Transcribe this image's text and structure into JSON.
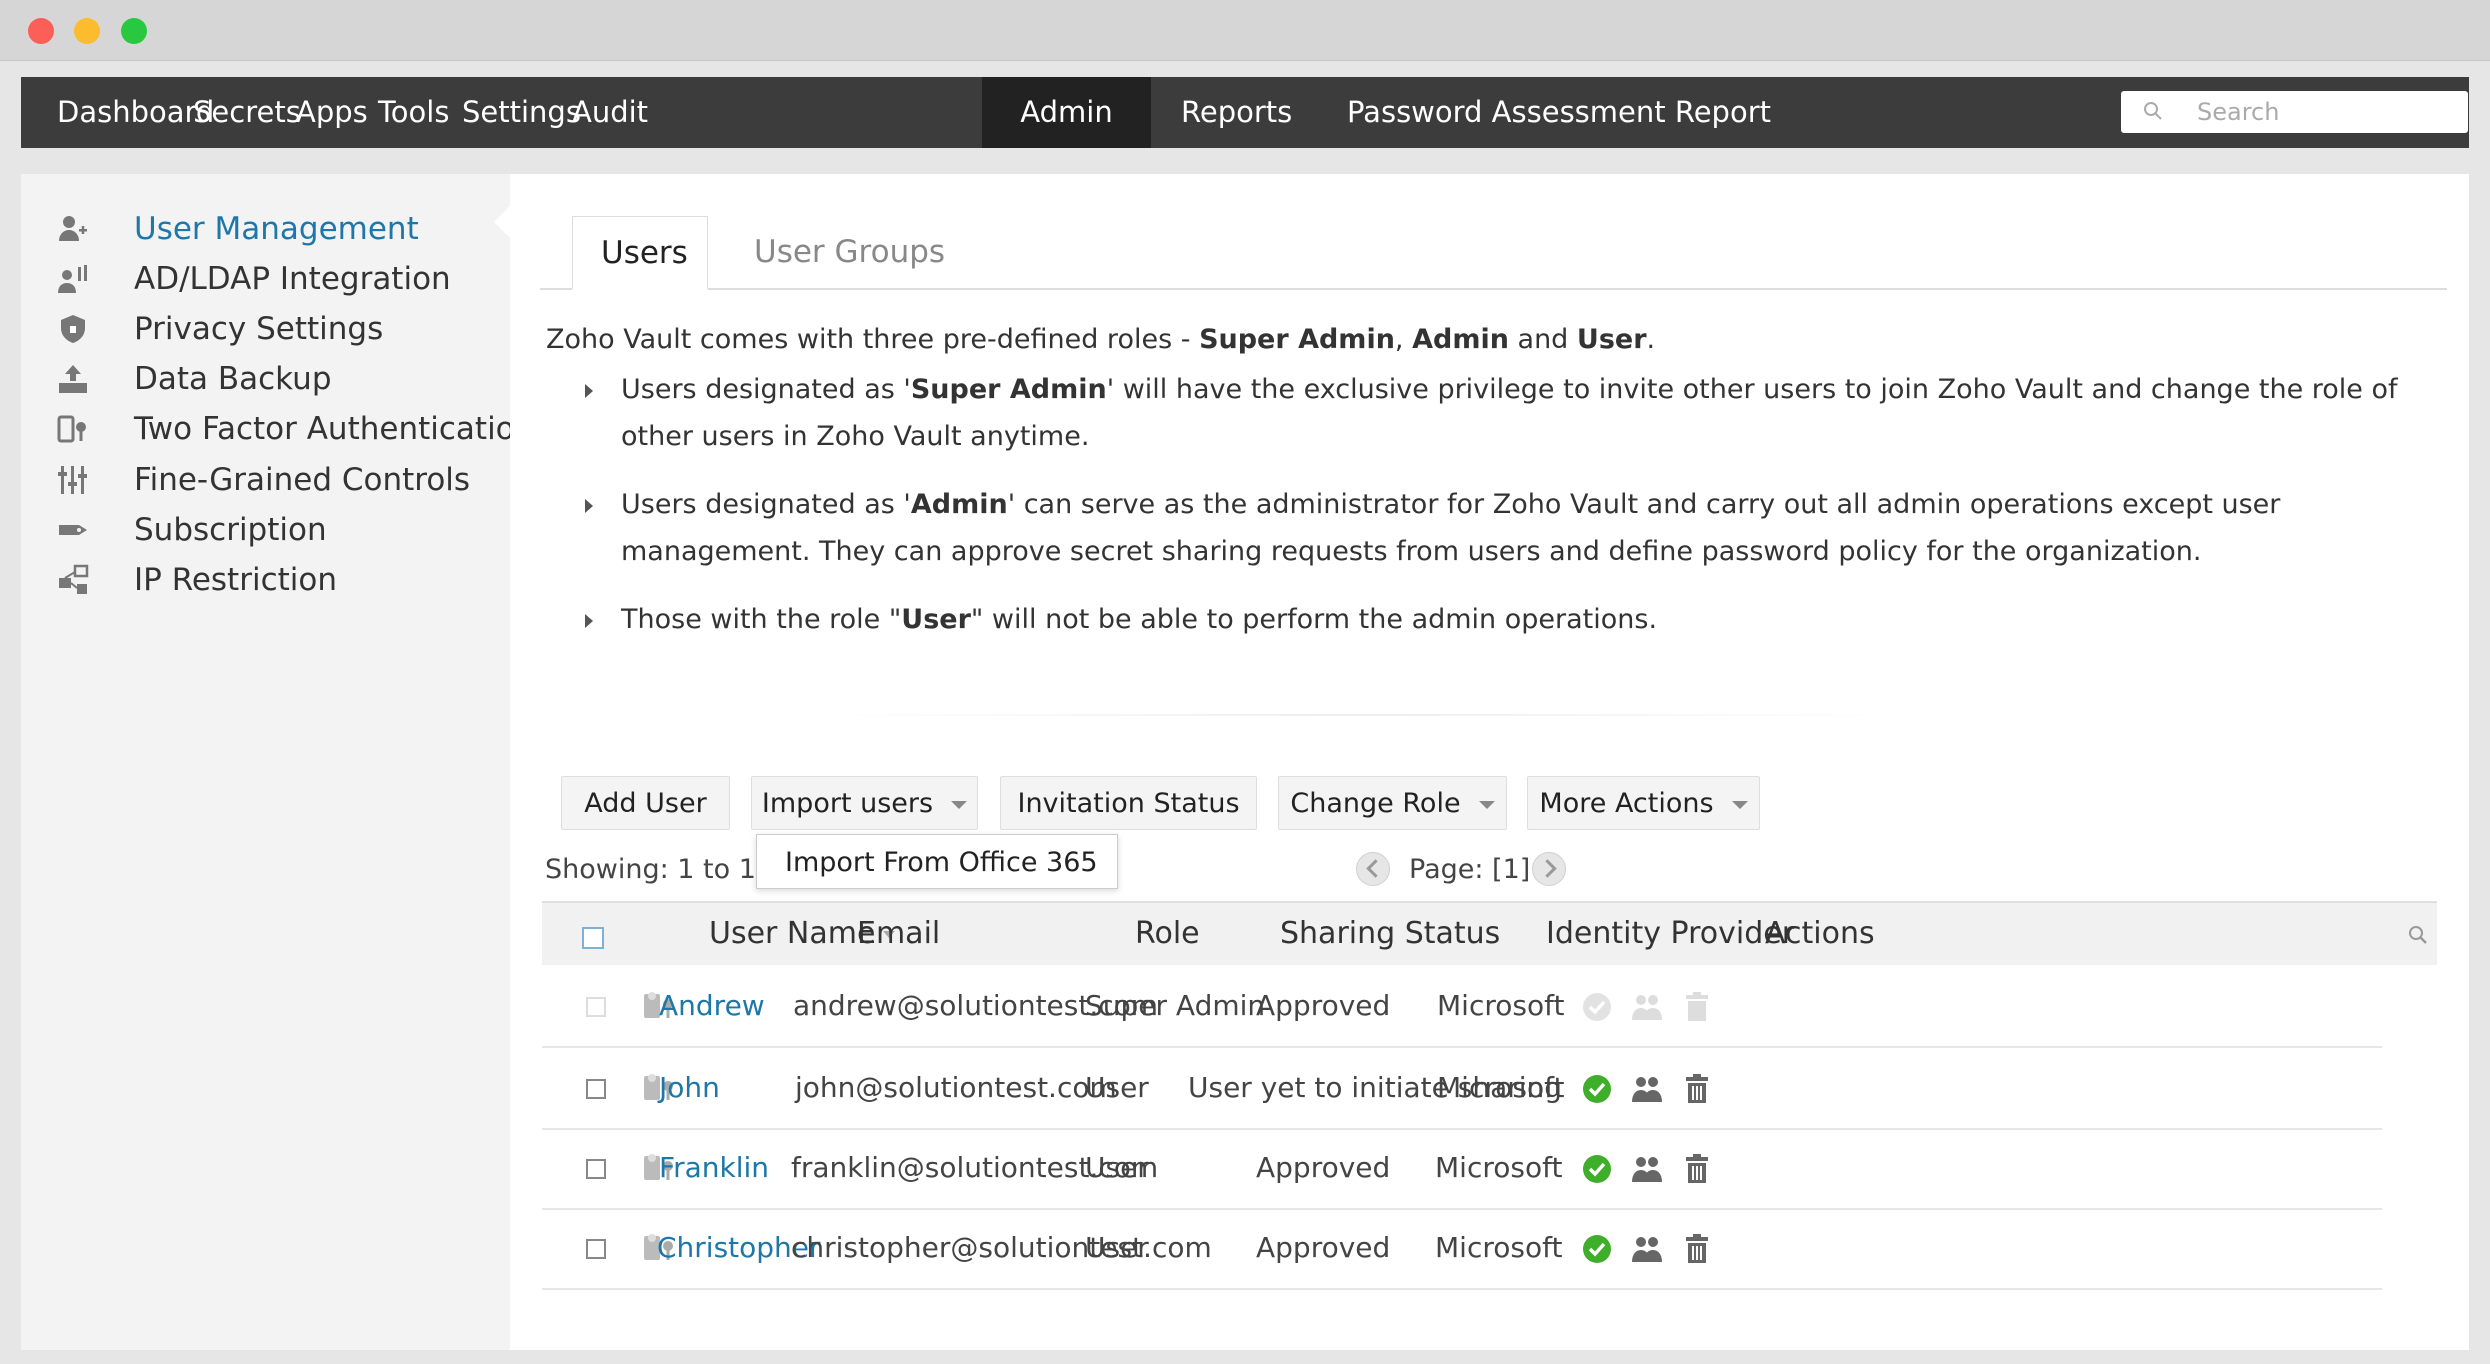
{
  "nav": {
    "items": [
      "Dashboard",
      "Secrets",
      "Apps",
      "Tools",
      "Settings",
      "Audit",
      "Admin",
      "Reports",
      "Password Assessment Report"
    ],
    "active": "Admin",
    "search_placeholder": "Search"
  },
  "sidebar": {
    "items": [
      {
        "label": "User Management",
        "icon": "user-add-icon",
        "active": true
      },
      {
        "label": "AD/LDAP Integration",
        "icon": "directory-sync-icon",
        "active": false
      },
      {
        "label": "Privacy Settings",
        "icon": "shield-icon",
        "active": false
      },
      {
        "label": "Data Backup",
        "icon": "backup-icon",
        "active": false
      },
      {
        "label": "Two Factor Authentication",
        "icon": "two-factor-icon",
        "active": false
      },
      {
        "label": "Fine-Grained Controls",
        "icon": "sliders-icon",
        "active": false
      },
      {
        "label": "Subscription",
        "icon": "tag-icon",
        "active": false
      },
      {
        "label": "IP Restriction",
        "icon": "network-icon",
        "active": false
      }
    ]
  },
  "tabs": [
    "Users",
    "User Groups"
  ],
  "intro": {
    "text": "Zoho Vault comes with three pre-defined roles - ",
    "r1": "Super Admin",
    "sep": ", ",
    "r2": "Admin",
    "and": " and ",
    "r3": "User",
    "end": "."
  },
  "bullets": [
    {
      "pre": "Users designated as '",
      "bold": "Super Admin",
      "post": "' will have the exclusive privilege to invite other users to join Zoho Vault and change the role of other users in Zoho Vault anytime."
    },
    {
      "pre": "Users designated as '",
      "bold": "Admin",
      "post": "' can serve as the administrator for Zoho Vault and carry out all admin operations except user management. They can approve secret sharing requests from users and define password policy for the organization."
    },
    {
      "pre": "Those with the role \"",
      "bold": "User",
      "post": "\" will not be able to perform the admin operations."
    }
  ],
  "toolbar": {
    "add_user": "Add User",
    "import_users": "Import users",
    "invitation_status": "Invitation Status",
    "change_role": "Change Role",
    "more_actions": "More Actions"
  },
  "dropdown": {
    "import_office365": "Import From Office 365"
  },
  "showing": "Showing: 1 to 1 o",
  "pager": {
    "label": "Page: [1]"
  },
  "table": {
    "headers": {
      "username": "User Name",
      "email": "Email",
      "role": "Role",
      "sharing": "Sharing Status",
      "idp": "Identity Provider",
      "actions": "Actions"
    },
    "rows": [
      {
        "name": "Andrew",
        "email": "andrew@solutiontest.com",
        "role": "Super Admin",
        "sharing": "Approved",
        "idp": "Microsoft",
        "disabled": true
      },
      {
        "name": "John",
        "email": "john@solutiontest.com",
        "role": "User",
        "sharing": "User yet to initiate sharing",
        "idp": "Microsoft",
        "disabled": false
      },
      {
        "name": "Franklin",
        "email": "franklin@solutiontest.com",
        "role": "User",
        "sharing": "Approved",
        "idp": "Microsoft",
        "disabled": false
      },
      {
        "name": "Christopher",
        "email": "christopher@solutiontest.com",
        "role": "User",
        "sharing": "Approved",
        "idp": "Microsoft",
        "disabled": false
      }
    ]
  },
  "colors": {
    "navbar": "#3c3c3c",
    "active_nav": "#222222",
    "link": "#1d77a8",
    "check_green": "#3fae2a"
  }
}
